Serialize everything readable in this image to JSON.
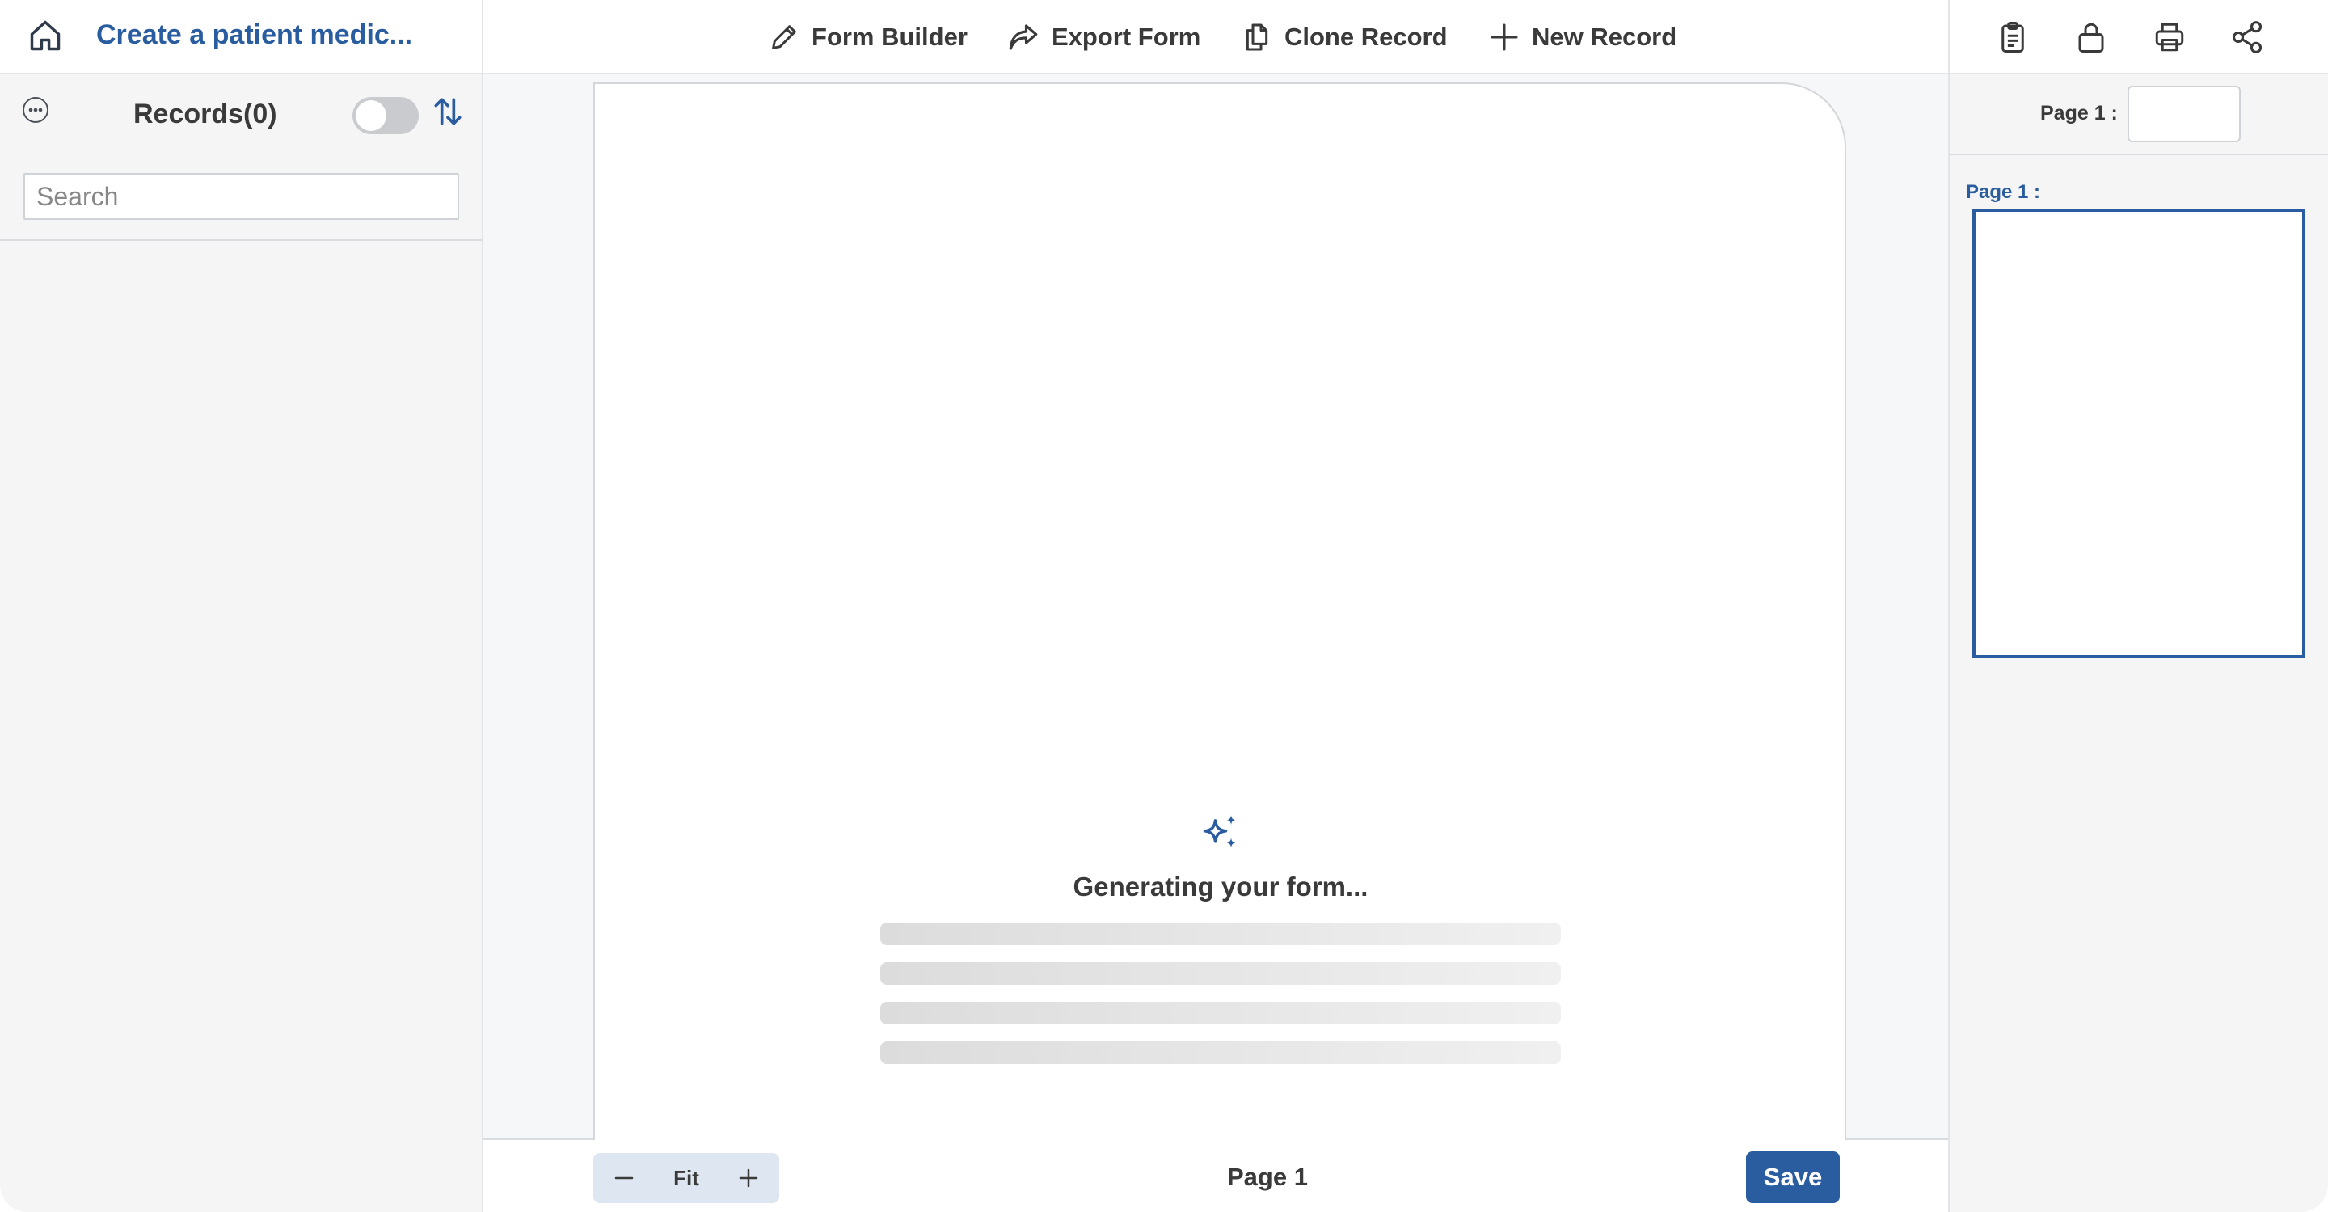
{
  "header": {
    "title": "Create a patient medic...",
    "home_icon": "home-icon"
  },
  "sidebar": {
    "records_label": "Records(0)",
    "search_placeholder": "Search",
    "toggle_on": false
  },
  "toolbar": {
    "items": [
      {
        "label": "Form Builder",
        "icon": "pencil-icon"
      },
      {
        "label": "Export Form",
        "icon": "share-arrow-icon"
      },
      {
        "label": "Clone Record",
        "icon": "copy-icon"
      },
      {
        "label": "New Record",
        "icon": "plus-icon"
      }
    ]
  },
  "right_header": {
    "icons": [
      "clipboard-icon",
      "lock-icon",
      "printer-icon",
      "share-icon"
    ]
  },
  "canvas": {
    "status_text": "Generating your form...",
    "skeleton_lines": 4
  },
  "bottom": {
    "zoom_fit_label": "Fit",
    "page_indicator": "Page 1",
    "save_label": "Save"
  },
  "right_panel": {
    "page_field_label": "Page 1 :",
    "thumbnail_label": "Page 1 :"
  },
  "colors": {
    "accent": "#2a5d9f",
    "panel_bg": "#f5f5f6",
    "border": "#e2e4e8"
  }
}
